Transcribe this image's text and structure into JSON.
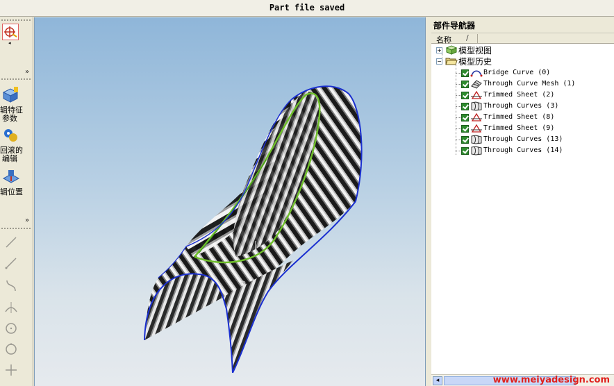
{
  "status": {
    "message": "Part file saved"
  },
  "toolbar": {
    "items": [
      {
        "label_line1": "辑特征",
        "label_line2": "参数",
        "icon": "edit-feature-parameters-icon"
      },
      {
        "label_line1": "回滚的",
        "label_line2": "编辑",
        "icon": "edit-with-rollback-icon"
      },
      {
        "label_line1": "辑位置",
        "label_line2": "",
        "icon": "edit-positioning-icon"
      }
    ],
    "more_glyph": "»",
    "sketch_tools": [
      "line-icon",
      "line-icon",
      "arc-icon",
      "tangent-icon",
      "circle-icon",
      "circle-icon",
      "point-icon"
    ]
  },
  "navigator": {
    "title": "部件导航器",
    "column_name": "名称",
    "column_sort": "/",
    "groups": [
      {
        "label": "模型视图",
        "expander": "+"
      },
      {
        "label": "模型历史",
        "expander": "−"
      }
    ],
    "features": [
      {
        "name": "Bridge Curve (0)",
        "icon": "bridge-curve-icon"
      },
      {
        "name": "Through Curve Mesh (1)",
        "icon": "through-curve-mesh-icon"
      },
      {
        "name": "Trimmed Sheet (2)",
        "icon": "trimmed-sheet-icon"
      },
      {
        "name": "Through Curves (3)",
        "icon": "through-curves-icon"
      },
      {
        "name": "Trimmed Sheet (8)",
        "icon": "trimmed-sheet-icon"
      },
      {
        "name": "Trimmed Sheet (9)",
        "icon": "trimmed-sheet-icon"
      },
      {
        "name": "Through Curves (13)",
        "icon": "through-curves-icon"
      },
      {
        "name": "Through Curves (14)",
        "icon": "through-curves-icon"
      }
    ]
  },
  "watermark": "www.meiyadesign.com",
  "colors": {
    "surface_edge": "#1a2fd0",
    "highlight_curve": "#6fbf2a",
    "checkbox": "#2e8b2e"
  }
}
